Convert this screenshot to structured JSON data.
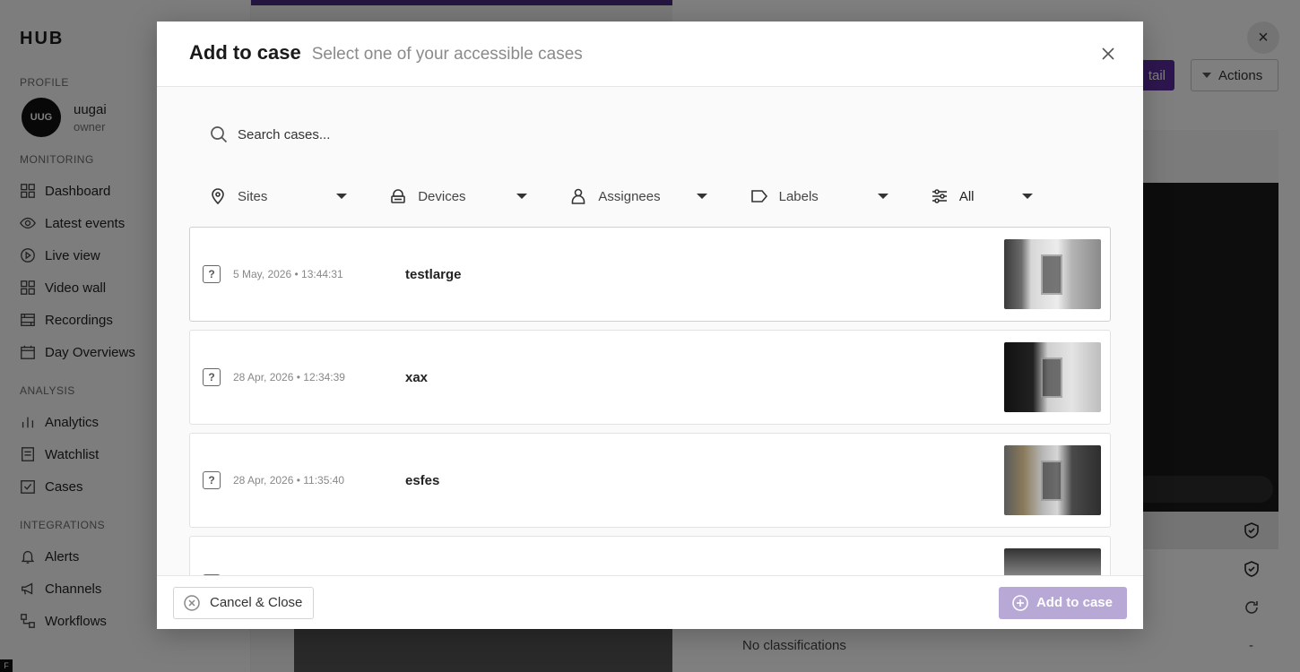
{
  "app": {
    "brand": "HUB",
    "profile": {
      "section_label": "PROFILE",
      "avatar_initials": "UUG",
      "name": "uugai",
      "role": "owner"
    },
    "monitoring": {
      "section_label": "MONITORING",
      "items": [
        {
          "label": "Dashboard",
          "icon": "grid-icon"
        },
        {
          "label": "Latest events",
          "icon": "eye-icon"
        },
        {
          "label": "Live view",
          "icon": "play-circle-icon"
        },
        {
          "label": "Video wall",
          "icon": "grid-icon"
        },
        {
          "label": "Recordings",
          "icon": "film-icon"
        },
        {
          "label": "Day Overviews",
          "icon": "calendar-icon"
        }
      ]
    },
    "analysis": {
      "section_label": "ANALYSIS",
      "items": [
        {
          "label": "Analytics",
          "icon": "bar-chart-icon"
        },
        {
          "label": "Watchlist",
          "icon": "list-icon"
        },
        {
          "label": "Cases",
          "icon": "checkbox-icon"
        }
      ]
    },
    "integrations": {
      "section_label": "INTEGRATIONS",
      "items": [
        {
          "label": "Alerts",
          "icon": "bell-icon"
        },
        {
          "label": "Channels",
          "icon": "megaphone-icon"
        },
        {
          "label": "Workflows",
          "icon": "workflow-icon"
        }
      ]
    },
    "corner_letter": "F",
    "detail": {
      "detail_button_label": "tail",
      "actions_label": "Actions",
      "no_classifications": "No classifications",
      "dash": "-"
    }
  },
  "modal": {
    "title": "Add to case",
    "subtitle": "Select one of your accessible cases",
    "search": {
      "placeholder": "Search cases..."
    },
    "filters": {
      "sites": "Sites",
      "devices": "Devices",
      "assignees": "Assignees",
      "labels": "Labels",
      "status": "All"
    },
    "cases": [
      {
        "date": "5 May, 2026 • 13:44:31",
        "name": "testlarge",
        "thumb": "thumb1"
      },
      {
        "date": "28 Apr, 2026 • 12:34:39",
        "name": "xax",
        "thumb": "thumb2"
      },
      {
        "date": "28 Apr, 2026 • 11:35:40",
        "name": "esfes",
        "thumb": "thumb3"
      },
      {
        "date": "",
        "name": "",
        "thumb": "thumb4"
      }
    ],
    "footer": {
      "cancel_label": "Cancel & Close",
      "add_label": "Add to case"
    },
    "colors": {
      "primary": "#5b2d9e",
      "primary_disabled": "#b7a8d6"
    }
  }
}
